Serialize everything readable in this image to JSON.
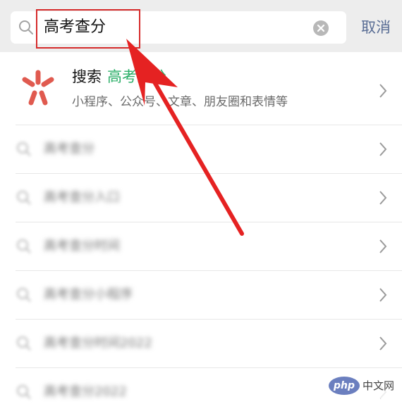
{
  "search": {
    "query": "高考查分",
    "cancel_label": "取消"
  },
  "result": {
    "prefix": "搜索",
    "keyword": "高考查分",
    "subtitle": "小程序、公众号、文章、朋友圈和表情等"
  },
  "suggestions": [
    {
      "text": "高考查分"
    },
    {
      "text": "高考查分入口"
    },
    {
      "text": "高考查分时间"
    },
    {
      "text": "高考查分小程序"
    },
    {
      "text": "高考查分时间2022"
    },
    {
      "text": "高考查分2022"
    }
  ],
  "watermark": {
    "logo": "php",
    "text": "中文网"
  },
  "colors": {
    "header_bg": "#ededed",
    "keyword_green": "#2aae67",
    "cancel_blue": "#586c94",
    "annotation_red": "#d62b2b"
  }
}
